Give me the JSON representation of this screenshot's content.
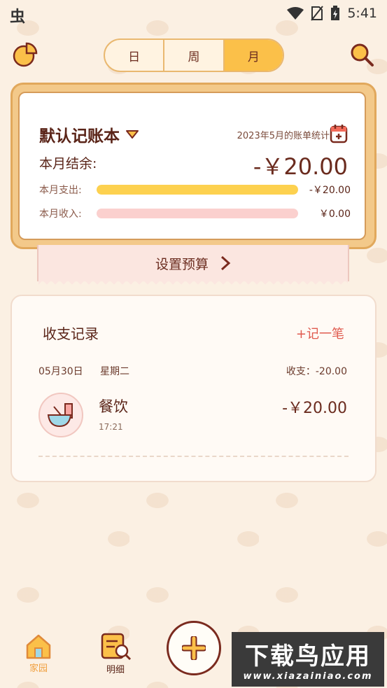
{
  "statusbar": {
    "app_glyph": "虫",
    "time": "5:41"
  },
  "header": {
    "segments": [
      "日",
      "周",
      "月"
    ],
    "active_segment": "月"
  },
  "summary": {
    "book_name": "默认记账本",
    "period_label": "2023年5月的账单统计",
    "balance_label": "本月结余:",
    "balance_amount": "-￥20.00",
    "expense_label": "本月支出:",
    "expense_value": "-￥20.00",
    "expense_fill": 1.0,
    "income_label": "本月收入:",
    "income_value": "￥0.00",
    "income_fill": 1.0,
    "budget_label": "设置预算",
    "colors": {
      "expense_bar": "#fdd14f",
      "income_bar": "#fbd0ce"
    }
  },
  "records": {
    "title": "收支记录",
    "add_label": "+记一笔",
    "day": {
      "date": "05月30日",
      "weekday": "星期二",
      "summary": "收支：-20.00",
      "entries": [
        {
          "category": "餐饮",
          "time": "17:21",
          "amount": "-￥20.00",
          "icon": "bowl-icon"
        }
      ]
    }
  },
  "bottomnav": {
    "items": [
      {
        "label": "家园",
        "icon": "house-icon"
      },
      {
        "label": "明细",
        "icon": "list-search-icon"
      }
    ]
  },
  "watermark": {
    "title": "下载鸟应用",
    "url": "www.xiazainiao.com"
  }
}
